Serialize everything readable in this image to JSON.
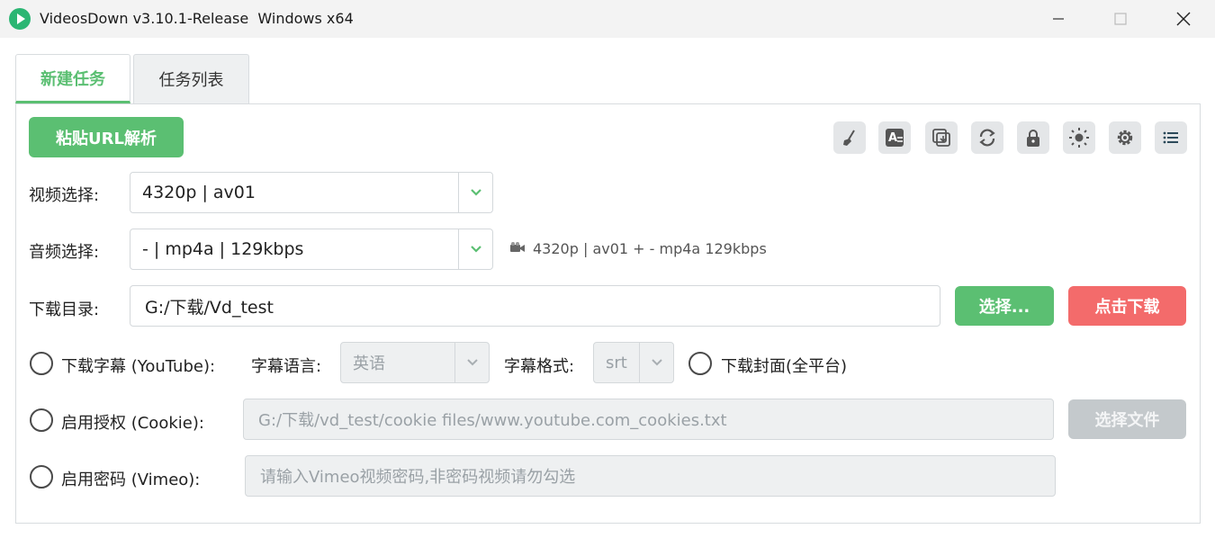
{
  "titlebar": {
    "title": "VideosDown v3.10.1-Release  Windows x64",
    "logo_color": "#2bb673",
    "minimize_icon": "minimize-icon",
    "maximize_icon": "maximize-icon",
    "close_icon": "close-icon"
  },
  "tabs": [
    {
      "label": "新建任务",
      "active": true
    },
    {
      "label": "任务列表",
      "active": false
    }
  ],
  "toolbar": {
    "paste_label": "粘贴URL解析",
    "tools": [
      "broom-icon",
      "translate-icon",
      "copy-icon",
      "refresh-icon",
      "lock-icon",
      "sun-icon",
      "gear-icon",
      "list-icon"
    ]
  },
  "video": {
    "label": "视频选择:",
    "value": "4320p | av01"
  },
  "audio": {
    "label": "音频选择:",
    "value": "- | mp4a | 129kbps",
    "combo_info": "4320p | av01 + - mp4a 129kbps"
  },
  "download_dir": {
    "label": "下载目录:",
    "value": "G:/下载/Vd_test",
    "select_label": "选择...",
    "download_label": "点击下载"
  },
  "subtitle": {
    "checkbox_label": "下载字幕 (YouTube):",
    "lang_label": "字幕语言:",
    "lang_value": "英语",
    "format_label": "字幕格式:",
    "format_value": "srt",
    "cover_label": "下载封面(全平台)"
  },
  "cookie": {
    "checkbox_label": "启用授权 (Cookie):",
    "path_value": "G:/下载/vd_test/cookie files/www.youtube.com_cookies.txt",
    "file_button_label": "选择文件"
  },
  "vimeo": {
    "checkbox_label": "启用密码 (Vimeo):",
    "placeholder": "请输入Vimeo视频密码,非密码视频请勿勾选"
  },
  "colors": {
    "accent_green": "#5bbf72",
    "download_red": "#f36b6b",
    "disabled_gray": "#c4c9cc"
  }
}
